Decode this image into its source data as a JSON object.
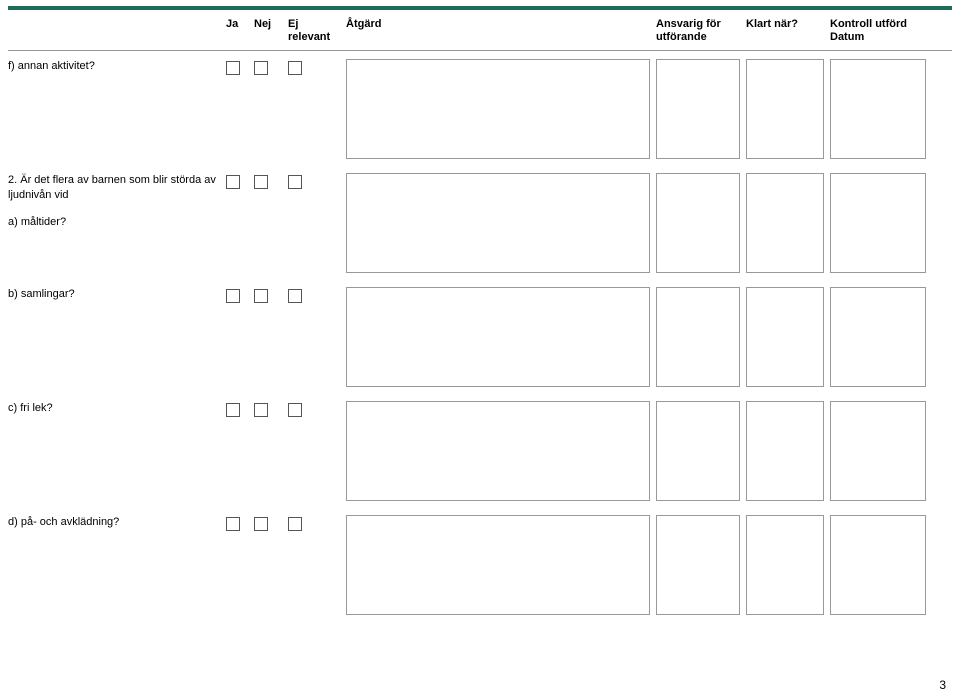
{
  "headers": {
    "ja": "Ja",
    "nej": "Nej",
    "ej_line1": "Ej",
    "ej_line2": "relevant",
    "atgard": "Åtgärd",
    "ansvarig_line1": "Ansvarig för",
    "ansvarig_line2": "utförande",
    "klart": "Klart när?",
    "kontroll_line1": "Kontroll utförd",
    "kontroll_line2": "Datum"
  },
  "rows": [
    {
      "question": "f) annan aktivitet?",
      "subquestion": ""
    },
    {
      "question": "2. Är det flera av barnen som blir störda av ljudnivån vid",
      "subquestion": "a) måltider?"
    },
    {
      "question": "b) samlingar?",
      "subquestion": ""
    },
    {
      "question": "c) fri lek?",
      "subquestion": ""
    },
    {
      "question": "d) på- och avklädning?",
      "subquestion": ""
    }
  ],
  "page_number": "3"
}
